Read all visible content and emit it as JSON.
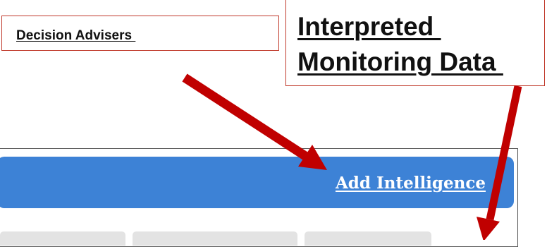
{
  "callouts": {
    "decision_advisers": "Decision Advisers ",
    "interpreted_line1": "Interpreted ",
    "interpreted_line2": "Monitoring Data "
  },
  "banner": {
    "link_label": "Add Intelligence"
  },
  "colors": {
    "banner": "#3d82d6",
    "arrow": "#c00000",
    "callout_border": "#c0392b"
  },
  "icons": [
    "arrow-to-add-intelligence-icon",
    "arrow-down-icon"
  ]
}
